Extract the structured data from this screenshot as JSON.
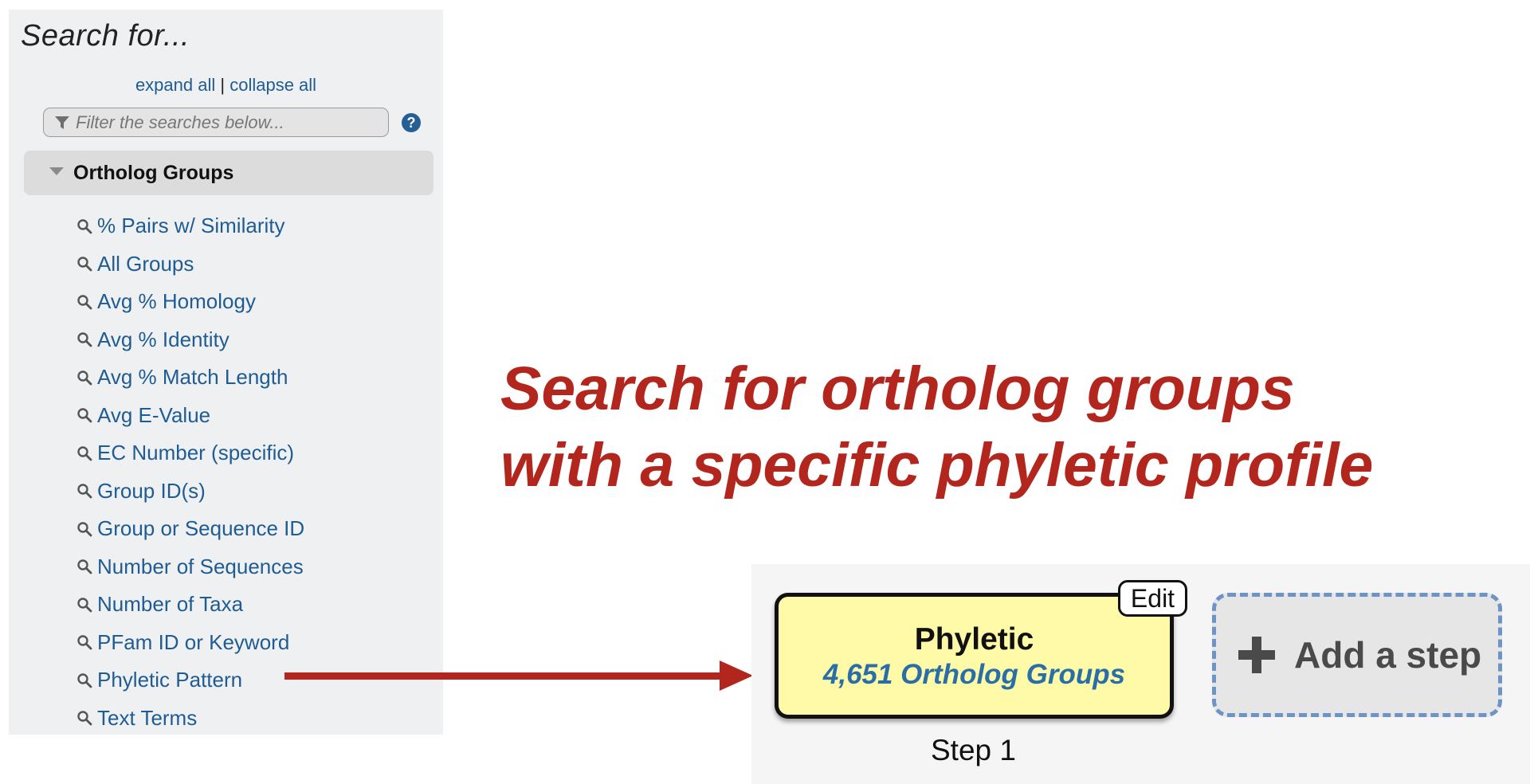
{
  "search_panel": {
    "title": "Search for...",
    "expand_all": "expand all",
    "separator": "|",
    "collapse_all": "collapse all",
    "filter_placeholder": "Filter the searches below...",
    "help_icon": "question-circle-icon",
    "group": {
      "label": "Ortholog Groups",
      "items": [
        {
          "label": "% Pairs w/ Similarity"
        },
        {
          "label": "All Groups"
        },
        {
          "label": "Avg % Homology"
        },
        {
          "label": "Avg % Identity"
        },
        {
          "label": "Avg % Match Length"
        },
        {
          "label": "Avg E-Value"
        },
        {
          "label": "EC Number (specific)"
        },
        {
          "label": "Group ID(s)"
        },
        {
          "label": "Group or Sequence ID"
        },
        {
          "label": "Number of Sequences"
        },
        {
          "label": "Number of Taxa"
        },
        {
          "label": "PFam ID or Keyword"
        },
        {
          "label": "Phyletic Pattern"
        },
        {
          "label": "Text Terms"
        }
      ]
    }
  },
  "annotation": {
    "line1": "Search for ortholog groups",
    "line2": "with a specific phyletic profile",
    "color": "#b3261e"
  },
  "strategy": {
    "step": {
      "name": "Phyletic",
      "count_text": "4,651 Ortholog Groups",
      "edit_label": "Edit",
      "caption": "Step 1"
    },
    "add_step_label": "Add a step"
  },
  "colors": {
    "link": "#1f5c93",
    "step_background": "#fefaa8",
    "add_step_border": "#6c94c6"
  }
}
